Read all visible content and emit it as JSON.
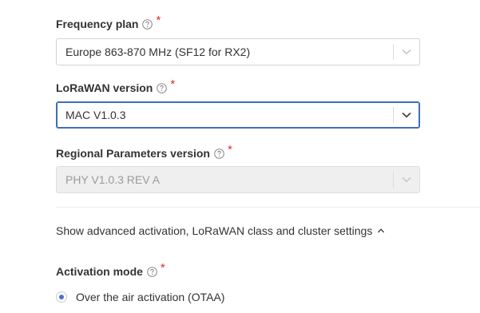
{
  "frequency_plan": {
    "label": "Frequency plan",
    "required_mark": "*",
    "value": "Europe 863-870 MHz (SF12 for RX2)"
  },
  "lorawan_version": {
    "label": "LoRaWAN version",
    "required_mark": "*",
    "value": "MAC V1.0.3"
  },
  "regional_parameters": {
    "label": "Regional Parameters version",
    "required_mark": "*",
    "value": "PHY V1.0.3 REV A"
  },
  "advanced_toggle": {
    "label": "Show advanced activation, LoRaWAN class and cluster settings"
  },
  "activation_mode": {
    "label": "Activation mode",
    "required_mark": "*",
    "options": [
      {
        "label": "Over the air activation (OTAA)",
        "selected": true
      }
    ]
  },
  "colors": {
    "required": "#d92d2d",
    "focus_border": "#3e6fb9",
    "radio_selected": "#4b6fd1",
    "disabled_bg": "#efefef"
  },
  "icons": {
    "help": "help-circle-icon",
    "dropdown": "chevron-down-icon",
    "collapse": "chevron-up-icon"
  }
}
